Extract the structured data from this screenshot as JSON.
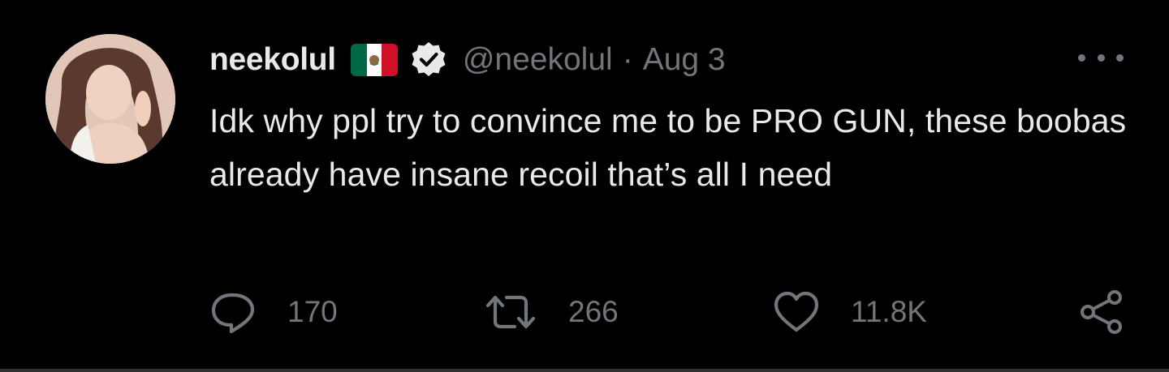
{
  "tweet": {
    "display_name": "neekolul",
    "handle": "@neekolul",
    "separator": "·",
    "date": "Aug 3",
    "text": "Idk why ppl try to convince me to be PRO GUN, these boobas already have insane recoil that’s all I need",
    "flag_icon": "mexico-flag-icon",
    "verified_icon": "verified-badge-icon"
  },
  "actions": {
    "reply": {
      "icon": "reply-bubble-icon",
      "count": "170"
    },
    "retweet": {
      "icon": "retweet-icon",
      "count": "266"
    },
    "like": {
      "icon": "heart-icon",
      "count": "11.8K"
    },
    "share": {
      "icon": "share-icon"
    }
  },
  "colors": {
    "background": "#000000",
    "primary_text": "#e7e9ea",
    "secondary_text": "#71767b",
    "divider": "#2f3336",
    "flag_green": "#006847",
    "flag_white": "#ffffff",
    "flag_red": "#ce1126"
  }
}
